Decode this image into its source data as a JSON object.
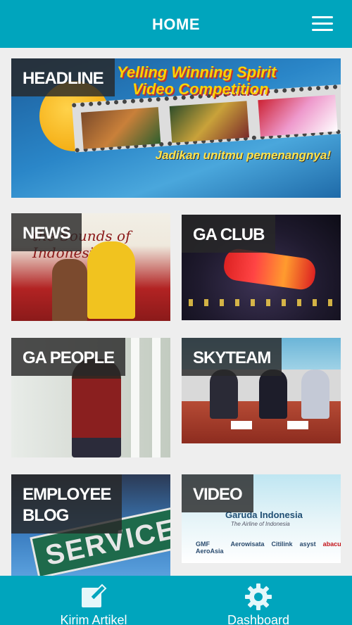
{
  "header": {
    "title": "HOME",
    "menu_icon": "hamburger-menu-icon"
  },
  "tiles": {
    "headline": {
      "label": "HEADLINE",
      "banner_title_line1": "Yelling Winning Spirit",
      "banner_title_line2": "Video Competition",
      "banner_tagline": "Jadikan unitmu pemenangnya!"
    },
    "news": {
      "label": "NEWS",
      "caption": "the Sounds of Indonesia"
    },
    "ga_club": {
      "label": "GA CLUB"
    },
    "ga_people": {
      "label": "GA PEOPLE"
    },
    "skyteam": {
      "label": "SKYTEAM"
    },
    "employee_blog": {
      "label_line1": "EMPLOYEE",
      "label_line2": "BLOG",
      "sign_text": "SERVICE"
    },
    "video": {
      "label": "VIDEO",
      "brand": "Garuda Indonesia",
      "brand_sub": "The Airline of Indonesia",
      "partners": [
        "GMF AeroAsia",
        "Aerowisata",
        "Citilink",
        "asyst",
        "abacus"
      ]
    }
  },
  "tabbar": {
    "items": [
      {
        "label": "Kirim Artikel",
        "icon": "edit-icon"
      },
      {
        "label": "Dashboard",
        "icon": "gear-icon"
      }
    ]
  },
  "colors": {
    "primary": "#00a5bd",
    "background": "#eeeeee",
    "label_bg": "#282828"
  }
}
